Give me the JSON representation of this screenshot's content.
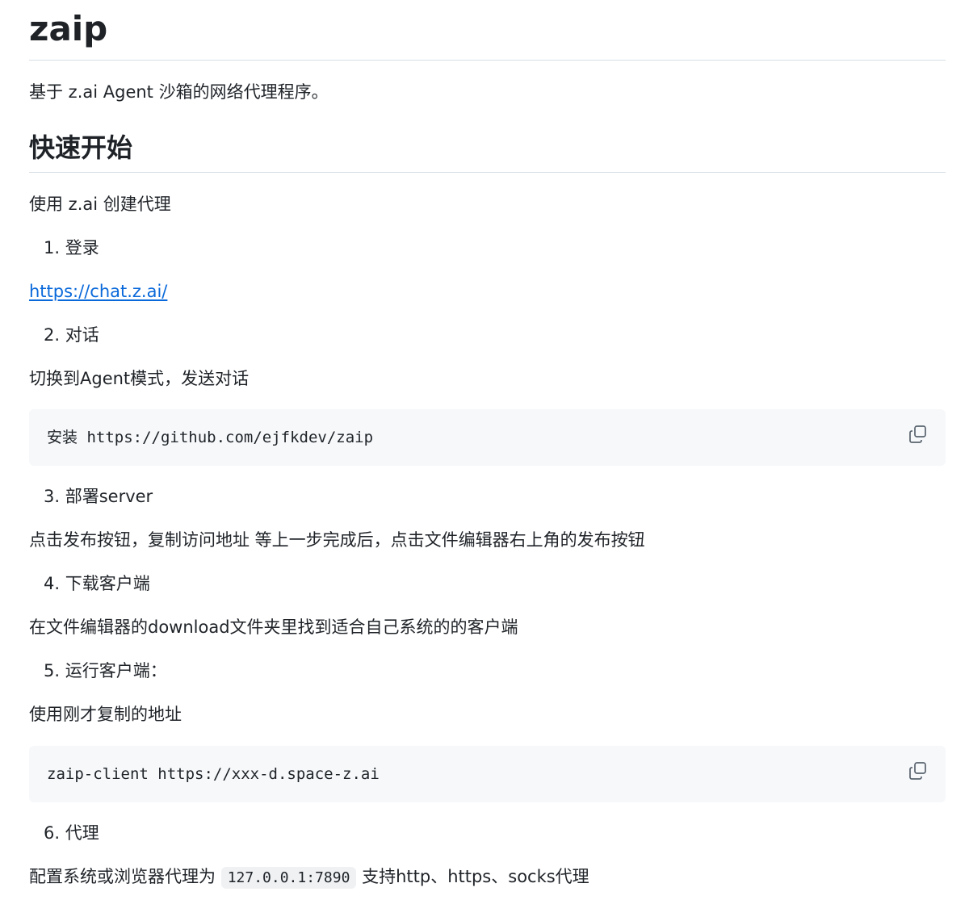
{
  "title": "zaip",
  "description": "基于 z.ai Agent 沙箱的网络代理程序。",
  "quickstart": {
    "heading": "快速开始",
    "intro": "使用 z.ai 创建代理",
    "step1": "1. 登录",
    "login_link": "https://chat.z.ai/",
    "step2": "2. 对话",
    "step2_text": "切换到Agent模式，发送对话",
    "code1": "安装 https://github.com/ejfkdev/zaip",
    "step3": "3. 部署server",
    "step3_text": "点击发布按钮，复制访问地址 等上一步完成后，点击文件编辑器右上角的发布按钮",
    "step4": "4. 下载客户端",
    "step4_text": "在文件编辑器的download文件夹里找到适合自己系统的的客户端",
    "step5": "5. 运行客户端：",
    "step5_text": "使用刚才复制的地址",
    "code2": "zaip-client https://xxx-d.space-z.ai",
    "step6": "6. 代理",
    "step6_prefix": "配置系统或浏览器代理为",
    "step6_code": "127.0.0.1:7890",
    "step6_suffix": "支持http、https、socks代理"
  },
  "icons": {
    "copy": "copy-icon"
  }
}
